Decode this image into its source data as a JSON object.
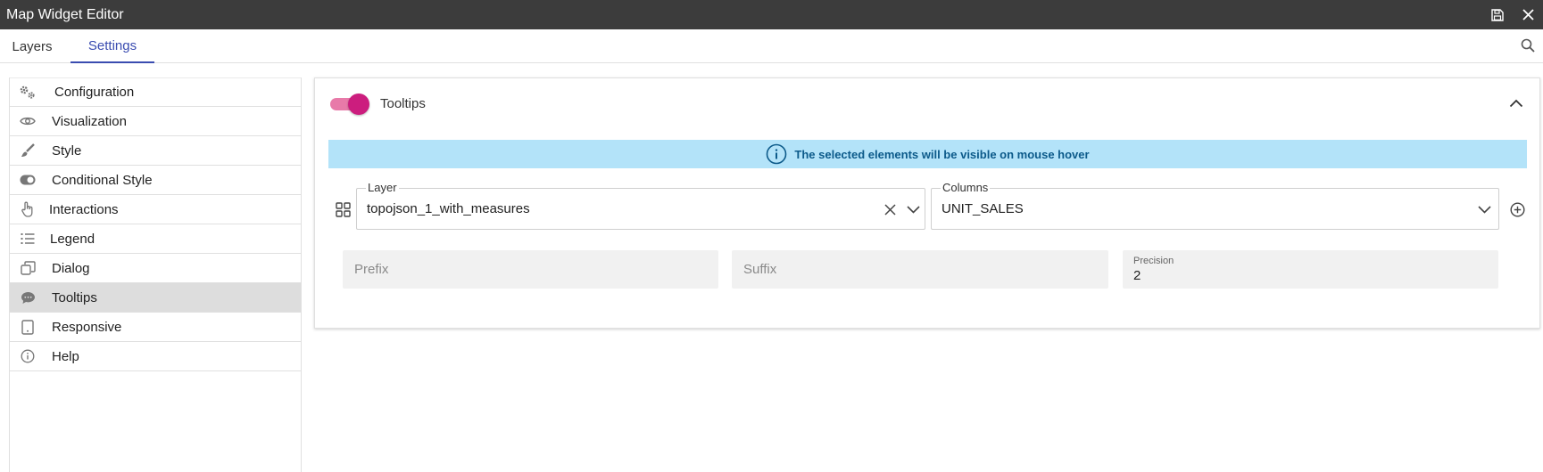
{
  "window": {
    "title": "Map Widget Editor",
    "save_icon": "save-icon",
    "close_icon": "close-icon"
  },
  "tabs": [
    {
      "label": "Layers"
    },
    {
      "label": "Settings",
      "active": true
    }
  ],
  "sidebar": {
    "items": [
      {
        "label": "Configuration",
        "icon": "gears-icon"
      },
      {
        "label": "Visualization",
        "icon": "eye-icon"
      },
      {
        "label": "Style",
        "icon": "brush-icon"
      },
      {
        "label": "Conditional Style",
        "icon": "toggle-icon"
      },
      {
        "label": "Interactions",
        "icon": "pointer-hand-icon"
      },
      {
        "label": "Legend",
        "icon": "list-icon"
      },
      {
        "label": "Dialog",
        "icon": "windows-icon"
      },
      {
        "label": "Tooltips",
        "icon": "comment-icon",
        "active": true
      },
      {
        "label": "Responsive",
        "icon": "tablet-icon"
      },
      {
        "label": "Help",
        "icon": "info-icon"
      }
    ]
  },
  "panel": {
    "title": "Tooltips",
    "enabled": true,
    "info": "The selected elements will be visible on mouse hover",
    "layer": {
      "label": "Layer",
      "value": "topojson_1_with_measures"
    },
    "columns": {
      "label": "Columns",
      "value": "UNIT_SALES"
    },
    "prefix": {
      "placeholder": "Prefix"
    },
    "suffix": {
      "placeholder": "Suffix"
    },
    "precision": {
      "label": "Precision",
      "value": "2"
    }
  },
  "colors": {
    "titlebar": "#3c3c3c",
    "accent": "#3a4cb0",
    "toggle_track": "#e87aa9",
    "toggle_thumb": "#cc1d7e",
    "info_bg": "#b3e3f9",
    "info_text": "#0c5a8a"
  }
}
